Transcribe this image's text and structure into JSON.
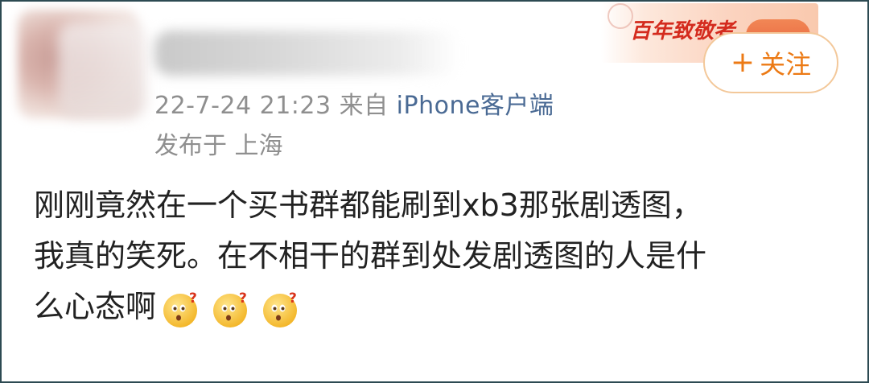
{
  "post": {
    "timestamp": "22-7-24 21:23",
    "source_prefix": "来自",
    "source": "iPhone客户端",
    "location": "发布于 上海",
    "follow_plus": "+",
    "follow_label": "关注",
    "banner_text": "百年致敬者",
    "text_lines": [
      "刚刚竟然在一个买书群都能刷到xb3那张剧透图，",
      "我真的笑死。在不相干的群到处发剧透图的人是什",
      "么心态啊"
    ],
    "emojis": [
      "confused-face-icon",
      "confused-face-icon",
      "confused-face-icon"
    ]
  },
  "colors": {
    "accent": "#ec7a15",
    "meta_text": "#8f8f8f",
    "source_link": "#4a6a94",
    "body_text": "#222222",
    "frame_border": "#2d4a52"
  }
}
